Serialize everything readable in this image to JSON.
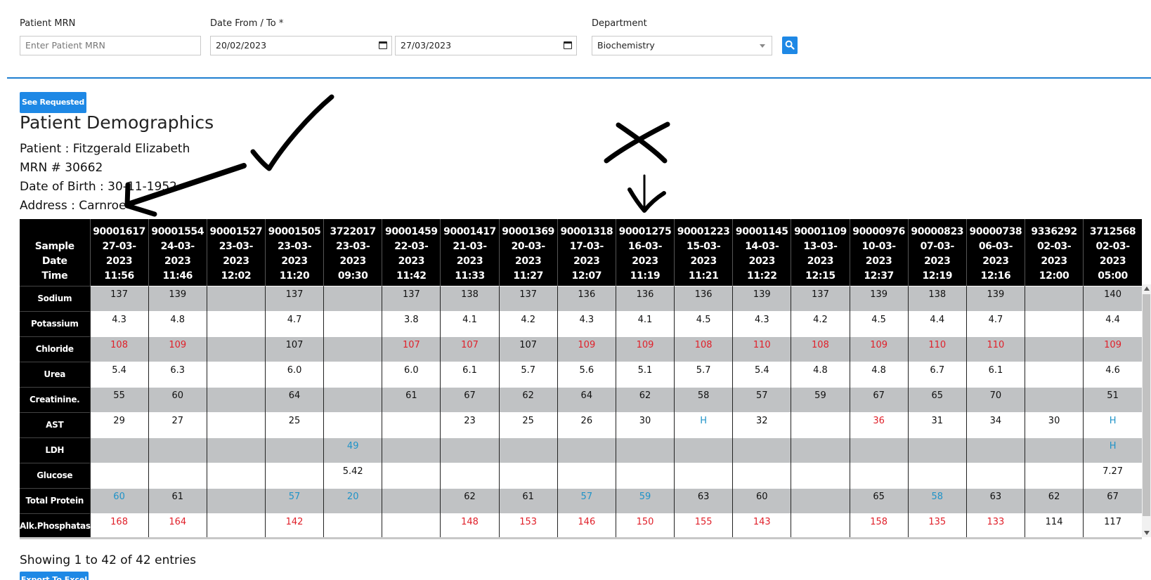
{
  "filters": {
    "mrn": {
      "label": "Patient MRN",
      "placeholder": "Enter Patient MRN"
    },
    "date": {
      "label": "Date From / To *",
      "from": "20/02/2023",
      "to": "27/03/2023"
    },
    "department": {
      "label": "Department",
      "value": "Biochemistry"
    }
  },
  "see_requested_label": "See Requested",
  "demographics": {
    "title": "Patient Demographics",
    "patient": "Patient : Fitzgerald Elizabeth",
    "mrn": "MRN # 30662",
    "dob": "Date of Birth : 30-11-1952",
    "address": "Address : Carnroe"
  },
  "table": {
    "corner": [
      "Sample",
      "Date",
      "Time"
    ],
    "columns": [
      [
        "90001617",
        "27-03-2023",
        "11:56"
      ],
      [
        "90001554",
        "24-03-",
        "2023",
        "11:46"
      ],
      [
        "90001527",
        "23-03-2023",
        "12:02"
      ],
      [
        "90001505",
        "23-03-",
        "2023",
        "11:20"
      ],
      [
        "3722017",
        "23-03-",
        "2023",
        "09:30"
      ],
      [
        "90001459",
        "22-03-",
        "2023",
        "11:42"
      ],
      [
        "90001417",
        "21-03-",
        "2023",
        "11:33"
      ],
      [
        "90001369",
        "20-03-",
        "2023",
        "11:27"
      ],
      [
        "90001318",
        "17-03-2023",
        "12:07"
      ],
      [
        "90001275",
        "16-03-",
        "2023",
        "11:19"
      ],
      [
        "90001223",
        "15-03-",
        "2023",
        "11:21"
      ],
      [
        "90001145",
        "14-03-",
        "2023",
        "11:22"
      ],
      [
        "90001109",
        "13-03-",
        "2023",
        "12:15"
      ],
      [
        "90000976",
        "10-03-",
        "2023",
        "12:37"
      ],
      [
        "90000823",
        "07-03-2023",
        "12:19"
      ],
      [
        "90000738",
        "06-03-",
        "2023",
        "12:16"
      ],
      [
        "9336292",
        "02-03-",
        "2023",
        "12:00"
      ],
      [
        "3712568",
        "02-03-",
        "2023",
        "05:00"
      ]
    ],
    "rows": [
      {
        "name": "Sodium",
        "cells": [
          [
            "137",
            "n"
          ],
          [
            "139",
            "n"
          ],
          [
            "",
            ""
          ],
          [
            "137",
            "n"
          ],
          [
            "",
            ""
          ],
          [
            "137",
            "n"
          ],
          [
            "138",
            "n"
          ],
          [
            "137",
            "n"
          ],
          [
            "136",
            "n"
          ],
          [
            "136",
            "n"
          ],
          [
            "136",
            "n"
          ],
          [
            "139",
            "n"
          ],
          [
            "137",
            "n"
          ],
          [
            "139",
            "n"
          ],
          [
            "138",
            "n"
          ],
          [
            "139",
            "n"
          ],
          [
            "",
            ""
          ],
          [
            "140",
            "n"
          ]
        ]
      },
      {
        "name": "Potassium",
        "cells": [
          [
            "4.3",
            "n"
          ],
          [
            "4.8",
            "n"
          ],
          [
            "",
            ""
          ],
          [
            "4.7",
            "n"
          ],
          [
            "",
            ""
          ],
          [
            "3.8",
            "n"
          ],
          [
            "4.1",
            "n"
          ],
          [
            "4.2",
            "n"
          ],
          [
            "4.3",
            "n"
          ],
          [
            "4.1",
            "n"
          ],
          [
            "4.5",
            "n"
          ],
          [
            "4.3",
            "n"
          ],
          [
            "4.2",
            "n"
          ],
          [
            "4.5",
            "n"
          ],
          [
            "4.4",
            "n"
          ],
          [
            "4.7",
            "n"
          ],
          [
            "",
            ""
          ],
          [
            "4.4",
            "n"
          ]
        ]
      },
      {
        "name": "Chloride",
        "cells": [
          [
            "108",
            "h"
          ],
          [
            "109",
            "h"
          ],
          [
            "",
            ""
          ],
          [
            "107",
            "n"
          ],
          [
            "",
            ""
          ],
          [
            "107",
            "h"
          ],
          [
            "107",
            "h"
          ],
          [
            "107",
            "n"
          ],
          [
            "109",
            "h"
          ],
          [
            "109",
            "h"
          ],
          [
            "108",
            "h"
          ],
          [
            "110",
            "h"
          ],
          [
            "108",
            "h"
          ],
          [
            "109",
            "h"
          ],
          [
            "110",
            "h"
          ],
          [
            "110",
            "h"
          ],
          [
            "",
            ""
          ],
          [
            "109",
            "h"
          ]
        ]
      },
      {
        "name": "Urea",
        "cells": [
          [
            "5.4",
            "n"
          ],
          [
            "6.3",
            "n"
          ],
          [
            "",
            ""
          ],
          [
            "6.0",
            "n"
          ],
          [
            "",
            ""
          ],
          [
            "6.0",
            "n"
          ],
          [
            "6.1",
            "n"
          ],
          [
            "5.7",
            "n"
          ],
          [
            "5.6",
            "n"
          ],
          [
            "5.1",
            "n"
          ],
          [
            "5.7",
            "n"
          ],
          [
            "5.4",
            "n"
          ],
          [
            "4.8",
            "n"
          ],
          [
            "4.8",
            "n"
          ],
          [
            "6.7",
            "n"
          ],
          [
            "6.1",
            "n"
          ],
          [
            "",
            ""
          ],
          [
            "4.6",
            "n"
          ]
        ]
      },
      {
        "name": "Creatinine.",
        "cells": [
          [
            "55",
            "n"
          ],
          [
            "60",
            "n"
          ],
          [
            "",
            ""
          ],
          [
            "64",
            "n"
          ],
          [
            "",
            ""
          ],
          [
            "61",
            "n"
          ],
          [
            "67",
            "n"
          ],
          [
            "62",
            "n"
          ],
          [
            "64",
            "n"
          ],
          [
            "62",
            "n"
          ],
          [
            "58",
            "n"
          ],
          [
            "57",
            "n"
          ],
          [
            "59",
            "n"
          ],
          [
            "67",
            "n"
          ],
          [
            "65",
            "n"
          ],
          [
            "70",
            "n"
          ],
          [
            "",
            ""
          ],
          [
            "51",
            "n"
          ]
        ]
      },
      {
        "name": "AST",
        "cells": [
          [
            "29",
            "n"
          ],
          [
            "27",
            "n"
          ],
          [
            "",
            ""
          ],
          [
            "25",
            "n"
          ],
          [
            "",
            ""
          ],
          [
            "",
            ""
          ],
          [
            "23",
            "n"
          ],
          [
            "25",
            "n"
          ],
          [
            "26",
            "n"
          ],
          [
            "30",
            "n"
          ],
          [
            "H",
            "l"
          ],
          [
            "32",
            "n"
          ],
          [
            "",
            ""
          ],
          [
            "36",
            "h"
          ],
          [
            "31",
            "n"
          ],
          [
            "34",
            "n"
          ],
          [
            "30",
            "n"
          ],
          [
            "H",
            "l"
          ]
        ]
      },
      {
        "name": "LDH",
        "cells": [
          [
            "",
            ""
          ],
          [
            "",
            ""
          ],
          [
            "",
            ""
          ],
          [
            "",
            ""
          ],
          [
            "49",
            "l"
          ],
          [
            "",
            ""
          ],
          [
            "",
            ""
          ],
          [
            "",
            ""
          ],
          [
            "",
            ""
          ],
          [
            "",
            ""
          ],
          [
            "",
            ""
          ],
          [
            "",
            ""
          ],
          [
            "",
            ""
          ],
          [
            "",
            ""
          ],
          [
            "",
            ""
          ],
          [
            "",
            ""
          ],
          [
            "",
            ""
          ],
          [
            "H",
            "l"
          ]
        ]
      },
      {
        "name": "Glucose",
        "cells": [
          [
            "",
            ""
          ],
          [
            "",
            ""
          ],
          [
            "",
            ""
          ],
          [
            "",
            ""
          ],
          [
            "5.42",
            "n"
          ],
          [
            "",
            ""
          ],
          [
            "",
            ""
          ],
          [
            "",
            ""
          ],
          [
            "",
            ""
          ],
          [
            "",
            ""
          ],
          [
            "",
            ""
          ],
          [
            "",
            ""
          ],
          [
            "",
            ""
          ],
          [
            "",
            ""
          ],
          [
            "",
            ""
          ],
          [
            "",
            ""
          ],
          [
            "",
            ""
          ],
          [
            "7.27",
            "n"
          ]
        ]
      },
      {
        "name": "Total Protein",
        "cells": [
          [
            "60",
            "l"
          ],
          [
            "61",
            "n"
          ],
          [
            "",
            ""
          ],
          [
            "57",
            "l"
          ],
          [
            "20",
            "l"
          ],
          [
            "",
            ""
          ],
          [
            "62",
            "n"
          ],
          [
            "61",
            "n"
          ],
          [
            "57",
            "l"
          ],
          [
            "59",
            "l"
          ],
          [
            "63",
            "n"
          ],
          [
            "60",
            "n"
          ],
          [
            "",
            ""
          ],
          [
            "65",
            "n"
          ],
          [
            "58",
            "l"
          ],
          [
            "63",
            "n"
          ],
          [
            "62",
            "n"
          ],
          [
            "67",
            "n"
          ]
        ]
      },
      {
        "name": "Alk.Phosphatase",
        "cells": [
          [
            "168",
            "h"
          ],
          [
            "164",
            "h"
          ],
          [
            "",
            ""
          ],
          [
            "142",
            "h"
          ],
          [
            "",
            ""
          ],
          [
            "",
            ""
          ],
          [
            "148",
            "h"
          ],
          [
            "153",
            "h"
          ],
          [
            "146",
            "h"
          ],
          [
            "150",
            "h"
          ],
          [
            "155",
            "h"
          ],
          [
            "143",
            "h"
          ],
          [
            "",
            ""
          ],
          [
            "158",
            "h"
          ],
          [
            "135",
            "h"
          ],
          [
            "133",
            "h"
          ],
          [
            "114",
            "n"
          ],
          [
            "117",
            "n"
          ]
        ]
      }
    ]
  },
  "entries_text": "Showing 1 to 42 of 42 entries",
  "export_label": "Export To Excel",
  "colors": {
    "accent": "#1e88e5",
    "high": "#e0202a",
    "low": "#1f93c8",
    "shade": "#c0c2c4",
    "header": "#000000"
  },
  "icons": {
    "search": "search-icon",
    "calendar": "calendar-icon",
    "dropdown": "chevron-down-icon"
  }
}
